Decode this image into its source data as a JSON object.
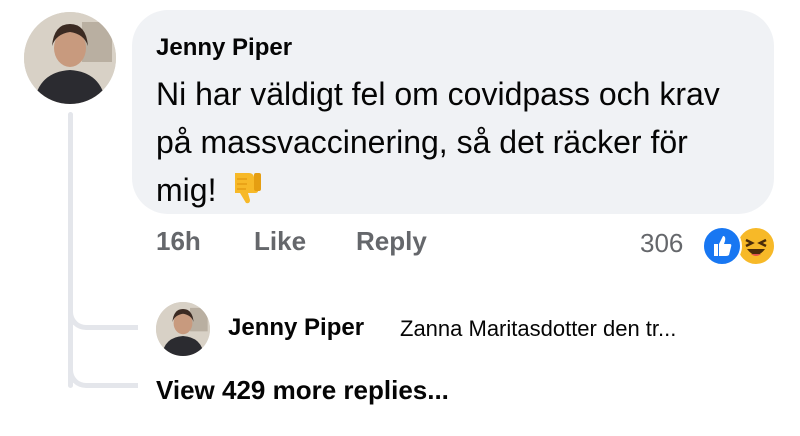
{
  "comment": {
    "author": "Jenny Piper",
    "text": "Ni har väldigt fel om covidpass och krav på massvaccinering, så det räcker för mig!",
    "emoji_icon": "thumbs-down-icon"
  },
  "actions": {
    "time": "16h",
    "like_label": "Like",
    "reply_label": "Reply"
  },
  "reactions": {
    "count": "306",
    "icons": [
      "like-reaction-icon",
      "haha-reaction-icon"
    ],
    "colors": {
      "like": "#1877f2",
      "haha": "#f7b928"
    }
  },
  "reply_preview": {
    "author": "Jenny Piper",
    "snippet": "Zanna Maritasdotter den tr..."
  },
  "view_more": {
    "label": "View 429 more replies..."
  }
}
